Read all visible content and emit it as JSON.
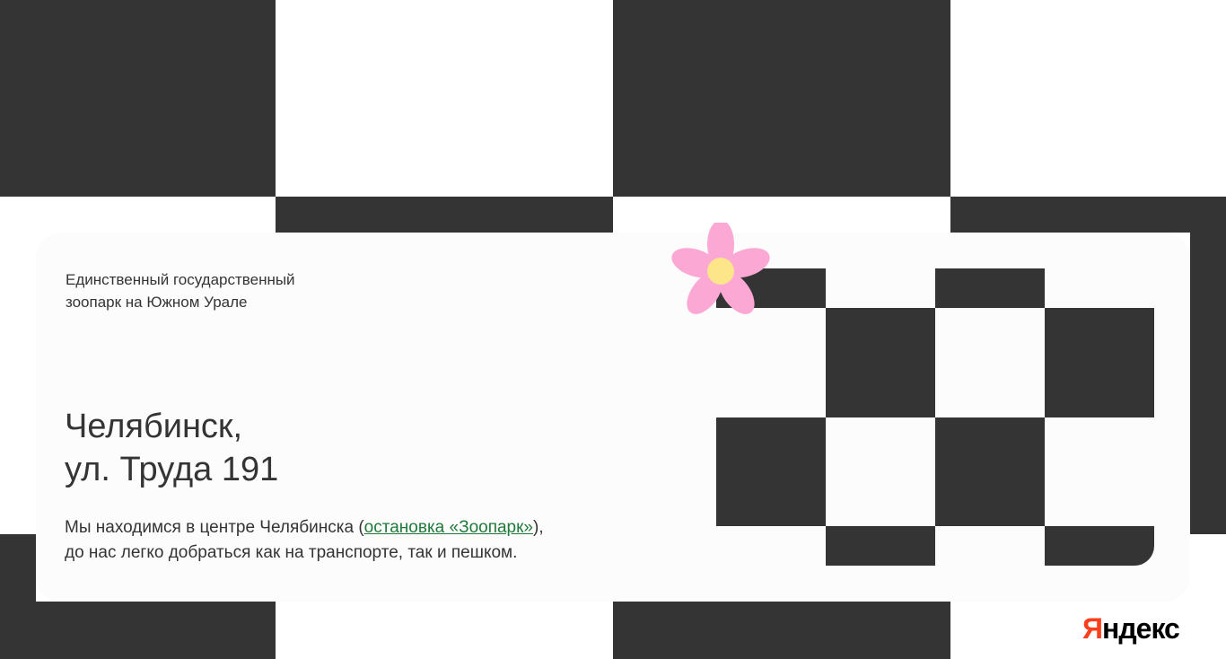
{
  "card": {
    "tagline_line1": "Единственный государственный",
    "tagline_line2": "зоопарк на Южном Урале",
    "title_line1": "Челябинск,",
    "title_line2": "ул. Труда 191",
    "desc_before": "Мы находимся в центре Челябинска (",
    "desc_link": "остановка «Зоопарк»",
    "desc_after": "),",
    "desc_line2": "до нас легко добраться как на транспорте, так и пешком."
  },
  "logo": {
    "first": "Я",
    "rest": "ндекс"
  },
  "colors": {
    "dark": "#343434",
    "card": "#fcfcfc",
    "link": "#1f7a3a",
    "petal": "#fba8d4",
    "flower_center": "#fde58a",
    "logo_accent": "#fc3f1d"
  },
  "icons": {
    "decoration": "flower-icon"
  }
}
